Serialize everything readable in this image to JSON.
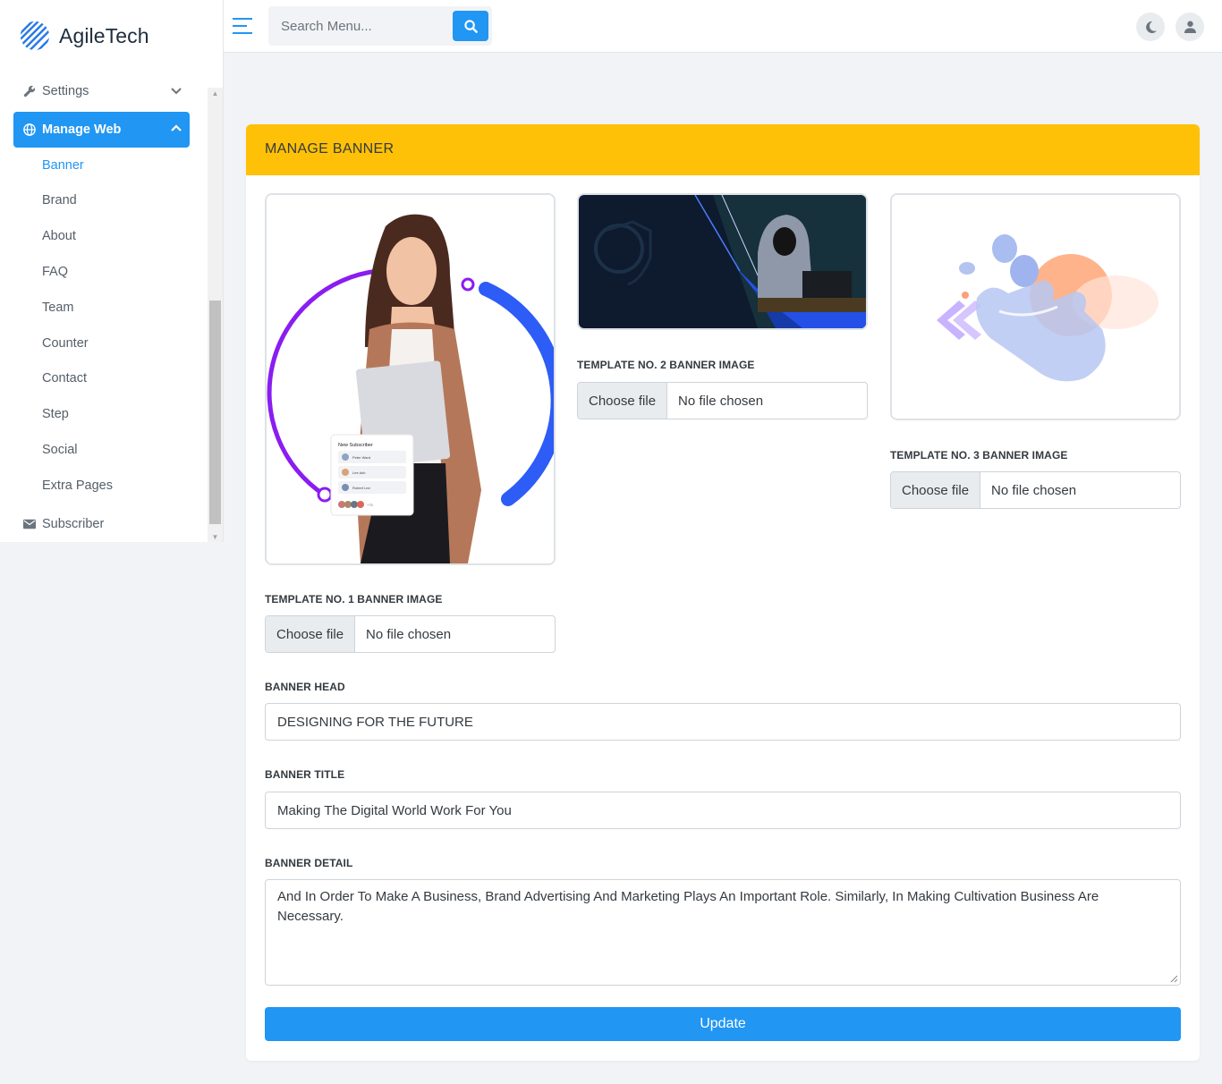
{
  "brand": {
    "name": "AgileTech"
  },
  "search": {
    "placeholder": "Search Menu..."
  },
  "sidebar": {
    "settings_label": "Settings",
    "manage_web_label": "Manage Web",
    "subitems": [
      "Banner",
      "Brand",
      "About",
      "FAQ",
      "Team",
      "Counter",
      "Contact",
      "Step",
      "Social",
      "Extra Pages"
    ],
    "subscriber_label": "Subscriber"
  },
  "card": {
    "title": "MANAGE BANNER",
    "template1_label": "TEMPLATE NO. 1 BANNER IMAGE",
    "template2_label": "TEMPLATE NO. 2 BANNER IMAGE",
    "template3_label": "TEMPLATE NO. 3 BANNER IMAGE",
    "file_button": "Choose file",
    "file_status": "No file chosen",
    "banner_head_label": "BANNER HEAD",
    "banner_head_value": "DESIGNING FOR THE FUTURE",
    "banner_title_label": "BANNER TITLE",
    "banner_title_value": "Making The Digital World Work For You",
    "banner_detail_label": "BANNER DETAIL",
    "banner_detail_value": "And In Order To Make A Business, Brand Advertising And Marketing Plays An Important Role. Similarly, In Making Cultivation Business Are Necessary.",
    "update_label": "Update",
    "subscriber_card_title": "New Subscriber",
    "subscribers": [
      "Peter Ward",
      "Lee Ash",
      "Robert Lee"
    ],
    "subscriber_more": "+75"
  },
  "colors": {
    "primary": "#2196f3",
    "header": "#ffc107",
    "sidebar_bg": "#ffffff",
    "page_bg": "#f1f3f6"
  }
}
